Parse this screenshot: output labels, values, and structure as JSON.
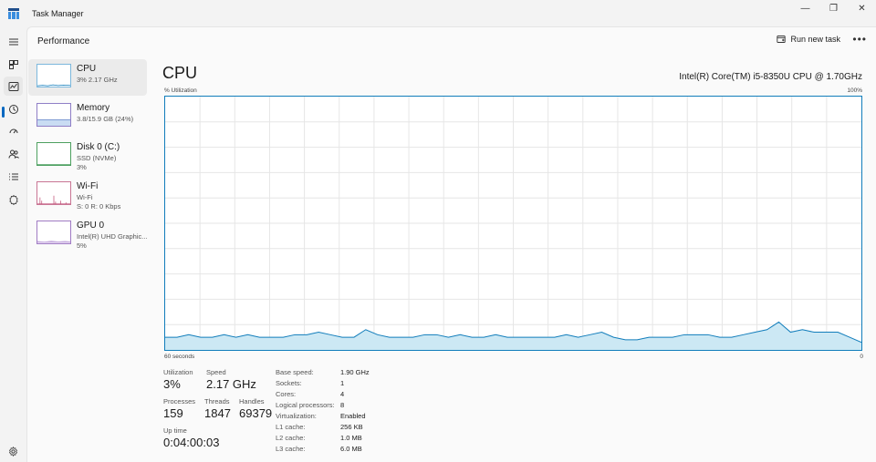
{
  "app": {
    "title": "Task Manager"
  },
  "window": {
    "minimize": "—",
    "maximize": "❐",
    "close": "✕"
  },
  "nav": {
    "icons": [
      "hamburger-icon",
      "processes-icon",
      "performance-icon",
      "app-history-icon",
      "startup-apps-icon",
      "users-icon",
      "details-icon",
      "services-icon"
    ],
    "settings_icon": "gear-icon"
  },
  "header": {
    "title": "Performance",
    "run_task": "Run new task",
    "more": "•••"
  },
  "devices": [
    {
      "name": "CPU",
      "lines": [
        "3% 2.17 GHz"
      ]
    },
    {
      "name": "Memory",
      "lines": [
        "3.8/15.9 GB (24%)"
      ]
    },
    {
      "name": "Disk 0 (C:)",
      "lines": [
        "SSD (NVMe)",
        "3%"
      ]
    },
    {
      "name": "Wi-Fi",
      "lines": [
        "Wi-Fi",
        "S: 0 R: 0 Kbps"
      ]
    },
    {
      "name": "GPU 0",
      "lines": [
        "Intel(R) UHD Graphic...",
        "5%"
      ]
    }
  ],
  "main": {
    "title": "CPU",
    "model": "Intel(R) Core(TM) i5-8350U CPU @ 1.70GHz",
    "y_label": "% Utilization",
    "y_max": "100%",
    "x_left": "60 seconds",
    "x_right": "0"
  },
  "chart_data": {
    "type": "area",
    "ylim": [
      0,
      100
    ],
    "x_points": 60,
    "values": [
      5,
      5,
      6,
      5,
      5,
      6,
      5,
      6,
      5,
      5,
      5,
      6,
      6,
      7,
      6,
      5,
      5,
      8,
      6,
      5,
      5,
      5,
      6,
      6,
      5,
      6,
      5,
      5,
      6,
      5,
      5,
      5,
      5,
      5,
      6,
      5,
      6,
      7,
      5,
      4,
      4,
      5,
      5,
      5,
      6,
      6,
      6,
      5,
      5,
      6,
      7,
      8,
      11,
      7,
      8,
      7,
      7,
      7,
      5,
      3
    ],
    "color": "#117dbb",
    "fill": "#cce8f4"
  },
  "stats": {
    "utilization_label": "Utilization",
    "utilization": "3%",
    "speed_label": "Speed",
    "speed": "2.17 GHz",
    "processes_label": "Processes",
    "processes": "159",
    "threads_label": "Threads",
    "threads": "1847",
    "handles_label": "Handles",
    "handles": "69379",
    "uptime_label": "Up time",
    "uptime": "0:04:00:03"
  },
  "specs": [
    {
      "label": "Base speed:",
      "value": "1.90 GHz"
    },
    {
      "label": "Sockets:",
      "value": "1"
    },
    {
      "label": "Cores:",
      "value": "4"
    },
    {
      "label": "Logical processors:",
      "value": "8"
    },
    {
      "label": "Virtualization:",
      "value": "Enabled"
    },
    {
      "label": "L1 cache:",
      "value": "256 KB"
    },
    {
      "label": "L2 cache:",
      "value": "1.0 MB"
    },
    {
      "label": "L3 cache:",
      "value": "6.0 MB"
    }
  ]
}
